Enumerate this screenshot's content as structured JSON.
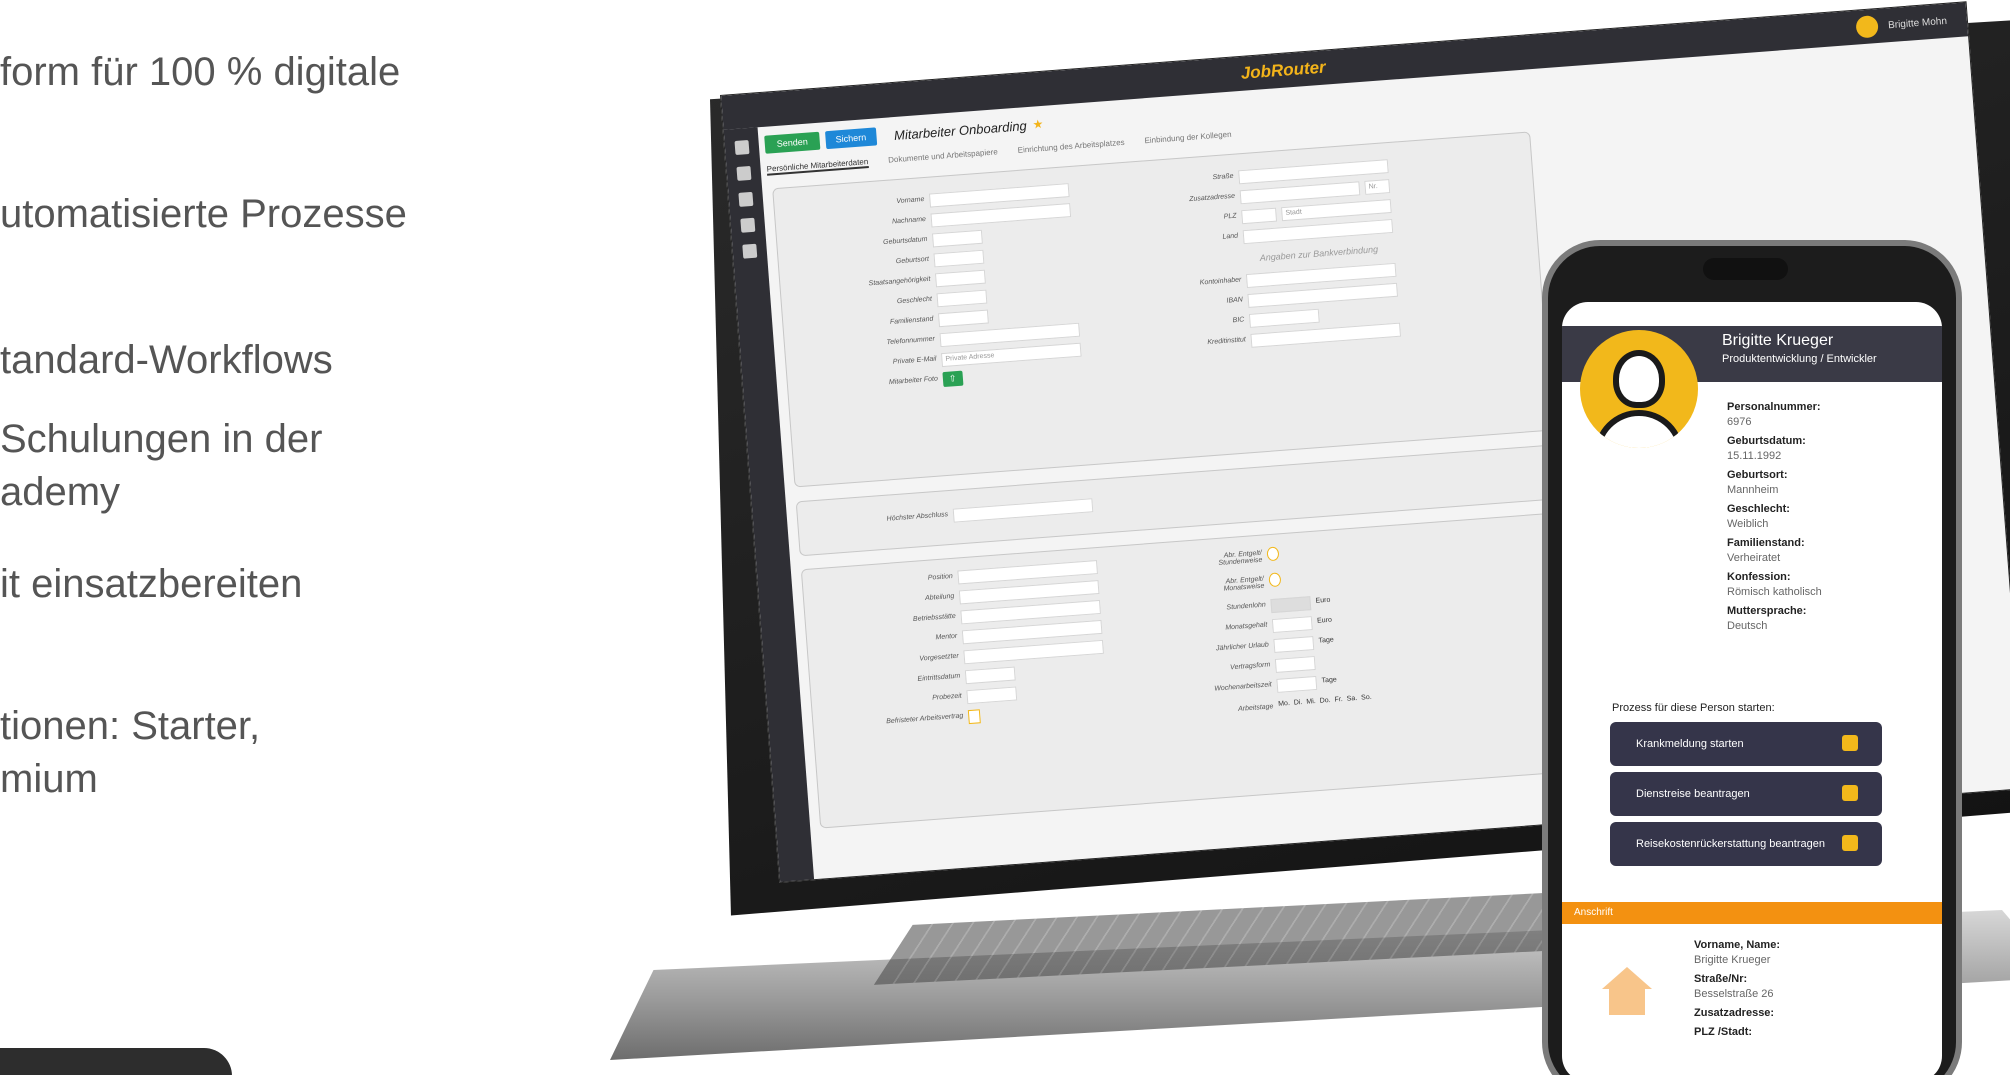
{
  "bullets": [
    "form für 100 % digitale",
    "utomatisierte Prozesse",
    "tandard-Workflows",
    "Schulungen in der",
    "ademy",
    "it einsatzbereiten",
    "tionen: Starter,",
    "mium"
  ],
  "app": {
    "brand": "JobRouter",
    "user_label": "Brigitte Mohn",
    "toolbar": {
      "send": "Senden",
      "save": "Sichern",
      "title": "Mitarbeiter Onboarding"
    },
    "tabs": [
      "Persönliche Mitarbeiterdaten",
      "Dokumente und Arbeitspapiere",
      "Einrichtung des Arbeitsplatzes",
      "Einbindung der Kollegen"
    ],
    "personal_fields": [
      "Vorname",
      "Nachname",
      "Geburtsdatum",
      "Geburtsort",
      "Staatsangehörigkeit",
      "Geschlecht",
      "Familienstand",
      "Telefonnummer",
      "Private E-Mail",
      "Mitarbeiter Foto"
    ],
    "email_placeholder": "Private Adresse",
    "address_fields": [
      "Straße",
      "Zusatzadresse",
      "PLZ",
      "Land"
    ],
    "nr_label": "Nr.",
    "city_placeholder": "Stadt",
    "bank_title": "Angaben zur Bankverbindung",
    "bank_fields": [
      "Kontoinhaber",
      "IBAN",
      "BIC",
      "Kreditinstitut"
    ],
    "education_label": "Höchster Abschluss",
    "employment_fields": [
      "Position",
      "Abteilung",
      "Betriebsstätte",
      "Mentor",
      "Vorgesetzter",
      "Eintrittsdatum",
      "Probezeit",
      "Befristeter Arbeitsvertrag"
    ],
    "pay_fields": [
      "Abr. Entgelt/ Stundenweise",
      "Abr. Entgelt/ Monatsweise",
      "Stundenlohn",
      "Monatsgehalt",
      "Jährlicher Urlaub",
      "Vertragsform",
      "Wochenarbeitszeit",
      "Arbeitstage"
    ],
    "units": [
      "Euro",
      "Euro",
      "Tage",
      "Tage"
    ],
    "weekdays": [
      "Mo.",
      "Di.",
      "Mi.",
      "Do.",
      "Fr.",
      "Sa.",
      "So."
    ]
  },
  "phone": {
    "name": "Brigitte Krueger",
    "subtitle": "Produktentwicklung / Entwickler",
    "info": [
      {
        "label": "Personalnummer:",
        "value": "6976"
      },
      {
        "label": "Geburtsdatum:",
        "value": "15.11.1992"
      },
      {
        "label": "Geburtsort:",
        "value": "Mannheim"
      },
      {
        "label": "Geschlecht:",
        "value": "Weiblich"
      },
      {
        "label": "Familienstand:",
        "value": "Verheiratet"
      },
      {
        "label": "Konfession:",
        "value": "Römisch katholisch"
      },
      {
        "label": "Muttersprache:",
        "value": "Deutsch"
      }
    ],
    "process_title": "Prozess für diese Person starten:",
    "process_buttons": [
      "Krankmeldung starten",
      "Dienstreise beantragen",
      "Reisekostenrückerstattung beantragen"
    ],
    "section": "Anschrift",
    "address": [
      {
        "label": "Vorname, Name:",
        "value": "Brigitte Krueger"
      },
      {
        "label": "Straße/Nr:",
        "value": "Besselstraße 26"
      },
      {
        "label": "Zusatzadresse:",
        "value": ""
      },
      {
        "label": "PLZ /Stadt:",
        "value": ""
      }
    ]
  }
}
